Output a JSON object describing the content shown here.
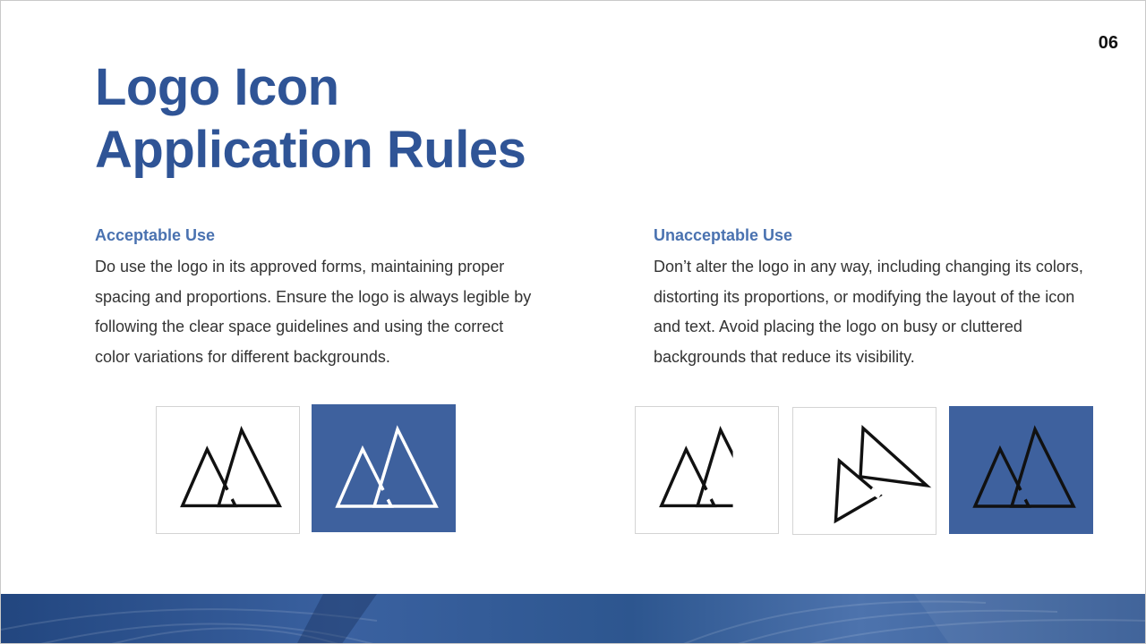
{
  "page_number": "06",
  "title": {
    "line1": "Logo Icon",
    "line2": "Application Rules"
  },
  "acceptable": {
    "heading": "Acceptable Use",
    "body": "Do use the logo in its approved forms, maintaining proper spacing and proportions. Ensure the logo is always legible by following the clear space guidelines and using the correct color variations for different backgrounds."
  },
  "unacceptable": {
    "heading": "Unacceptable Use",
    "body": "Don’t alter the logo in any way, including changing its colors, distorting its proportions, or modifying the layout of the icon and text. Avoid placing the logo on busy or cluttered backgrounds that reduce its visibility."
  },
  "colors": {
    "brand_blue": "#2f5496",
    "heading_blue": "#4a72b0",
    "tile_blue": "#3e619e",
    "logo_black": "#111111",
    "logo_white": "#ffffff"
  },
  "icons": {
    "logo": "mountain-logo-icon"
  }
}
